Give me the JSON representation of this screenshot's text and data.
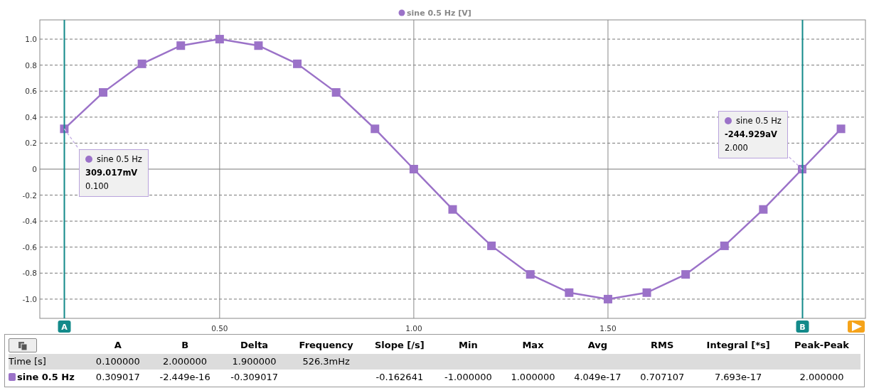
{
  "chart": {
    "legend": {
      "unit": "[V]"
    },
    "chart_data": {
      "type": "line",
      "grid": true,
      "x": [
        0.1,
        0.2,
        0.3,
        0.4,
        0.5,
        0.6,
        0.7,
        0.8,
        0.9,
        1.0,
        1.1,
        1.2,
        1.3,
        1.4,
        1.5,
        1.6,
        1.7,
        1.8,
        1.9,
        2.0,
        2.1
      ],
      "series": [
        {
          "name": "sine 0.5 Hz",
          "color": "#9b72c8",
          "marker": "square",
          "values": [
            0.31,
            0.59,
            0.81,
            0.95,
            1,
            0.95,
            0.81,
            0.59,
            0.31,
            0,
            -0.31,
            -0.59,
            -0.81,
            -0.95,
            -1,
            -0.95,
            -0.81,
            -0.59,
            -0.31,
            0,
            0.31
          ]
        }
      ],
      "xlim": [
        0.037,
        2.163
      ],
      "ylim": [
        -1.148,
        1.148
      ],
      "xticks": [
        {
          "value": 0.5,
          "label": "0.50"
        },
        {
          "value": 1.0,
          "label": "1.00"
        },
        {
          "value": 1.5,
          "label": "1.50"
        }
      ],
      "yticks": [
        {
          "value": 1.0,
          "label": "1.0"
        },
        {
          "value": 0.8,
          "label": "0.8"
        },
        {
          "value": 0.6,
          "label": "0.6"
        },
        {
          "value": 0.4,
          "label": "0.4"
        },
        {
          "value": 0.2,
          "label": "0.2"
        },
        {
          "value": 0,
          "label": "0"
        },
        {
          "value": -0.2,
          "label": "-0.2"
        },
        {
          "value": -0.4,
          "label": "-0.4"
        },
        {
          "value": -0.6,
          "label": "-0.6"
        },
        {
          "value": -0.8,
          "label": "-0.8"
        },
        {
          "value": -1.0,
          "label": "-1.0"
        }
      ],
      "ref_lines": [
        {
          "axis": "x",
          "value": 0.1,
          "label": "A",
          "color": "#138a8a"
        },
        {
          "axis": "x",
          "value": 2.0,
          "label": "B",
          "color": "#138a8a"
        }
      ]
    },
    "tooltips": [
      {
        "series": "sine 0.5 Hz",
        "value": "309.017mV",
        "x_value": "0.100"
      },
      {
        "series": "sine 0.5 Hz",
        "value": "-244.929aV",
        "x_value": "2.000"
      }
    ]
  },
  "table": {
    "columns": [
      "A",
      "B",
      "Delta",
      "Frequency",
      "Slope [/s]",
      "Min",
      "Max",
      "Avg",
      "RMS",
      "Integral [*s]",
      "Peak-Peak"
    ],
    "rows": [
      {
        "kind": "axis",
        "label": "Time [s]",
        "cells": [
          "0.100000",
          "2.000000",
          "1.900000",
          "526.3mHz",
          null,
          null,
          null,
          null,
          null,
          null,
          null
        ]
      },
      {
        "kind": "channel",
        "label": "sine 0.5 Hz",
        "color": "#9b72c8",
        "cells": [
          "0.309017",
          "-2.449e-16",
          "-0.309017",
          null,
          "-0.162641",
          "-1.000000",
          "1.000000",
          "4.049e-17",
          "0.707107",
          "7.693e-17",
          "2.000000"
        ]
      }
    ]
  }
}
